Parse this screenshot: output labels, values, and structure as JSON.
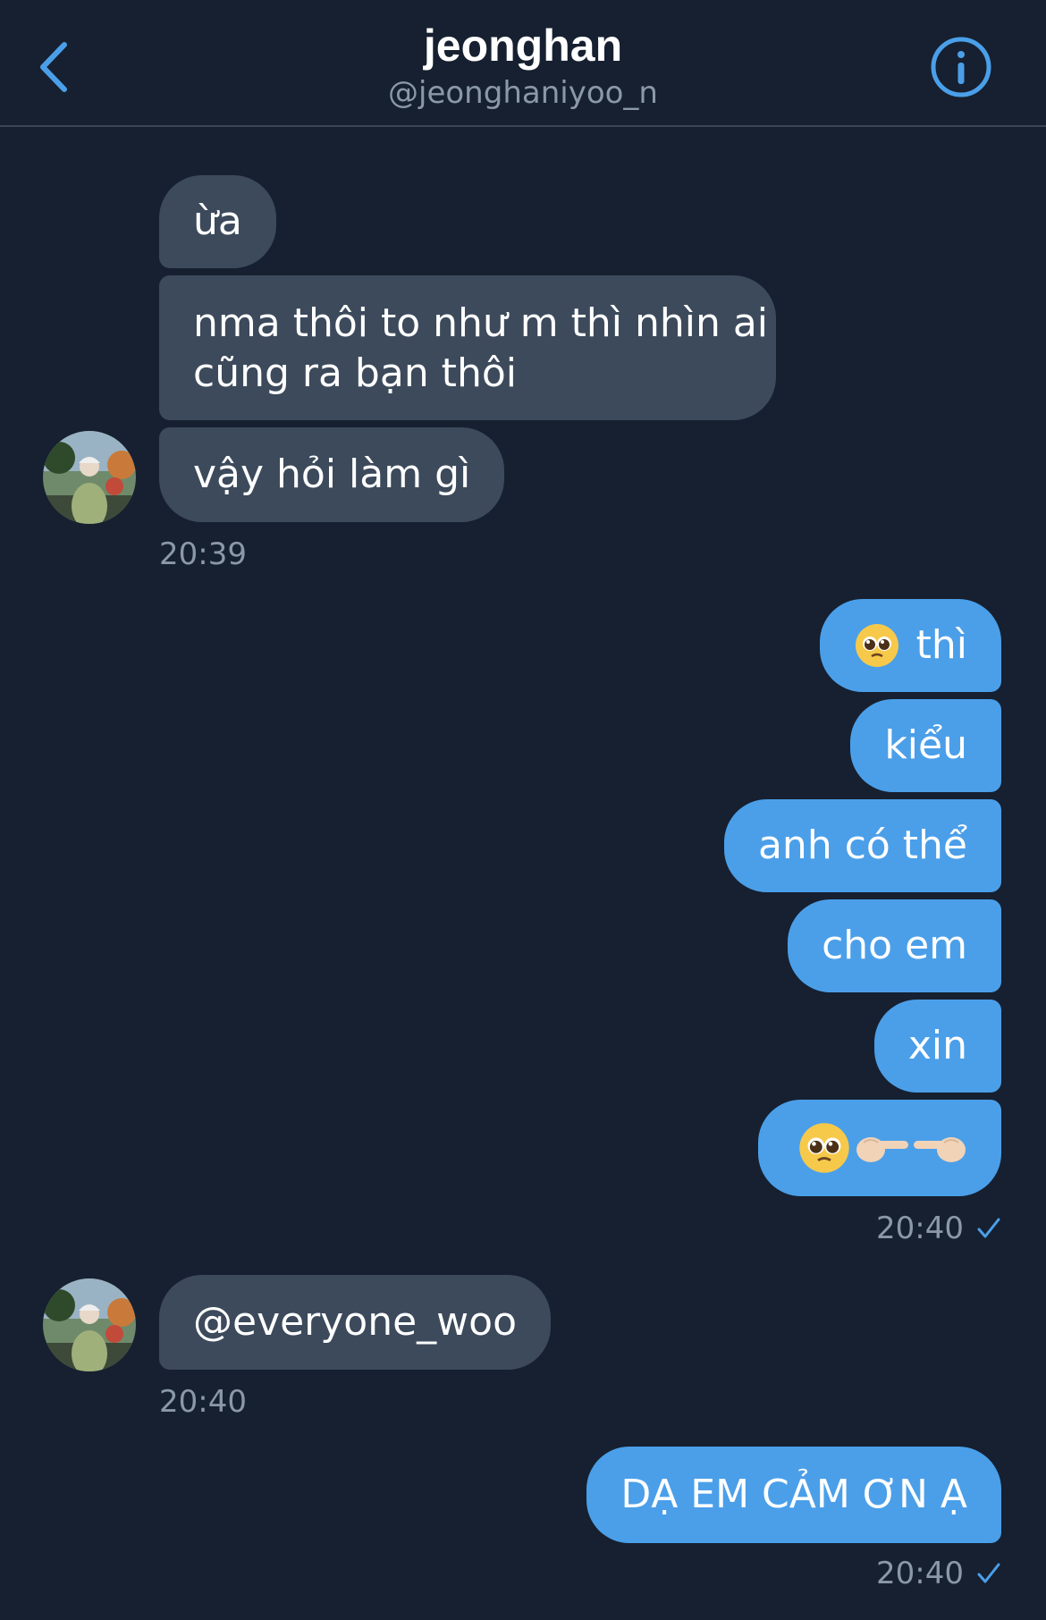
{
  "header": {
    "title": "jeonghan",
    "handle": "@jeonghaniyoo_n",
    "back_icon": "chevron-left-icon",
    "info_icon": "info-circle-icon",
    "accent_color": "#4b9fe9"
  },
  "messages": {
    "in1": {
      "line1": "ừa"
    },
    "in2": {
      "line1": "nma thôi to như m thì nhìn ai",
      "line2": "cũng ra bạn thôi"
    },
    "in3": {
      "line1": "vậy hỏi làm gì"
    },
    "ts1": "20:39",
    "out1": {
      "text": "thì",
      "emoji": "pleading-face"
    },
    "out2": {
      "text": "kiểu"
    },
    "out3": {
      "text": "anh có thể"
    },
    "out4": {
      "text": "cho em"
    },
    "out5": {
      "text": "xin"
    },
    "out6": {
      "emoji": "pleading-face fingers-pointing"
    },
    "ts2": "20:40",
    "in4": {
      "line1": "@everyone_woo"
    },
    "ts3": "20:40",
    "out7": {
      "text": "DẠ EM CẢM ƠN Ạ"
    },
    "ts4": "20:40"
  },
  "colors": {
    "background": "#162030",
    "incoming_bubble": "#3c4a5b",
    "outgoing_bubble": "#4b9fe9",
    "secondary_text": "#8b98a7"
  }
}
